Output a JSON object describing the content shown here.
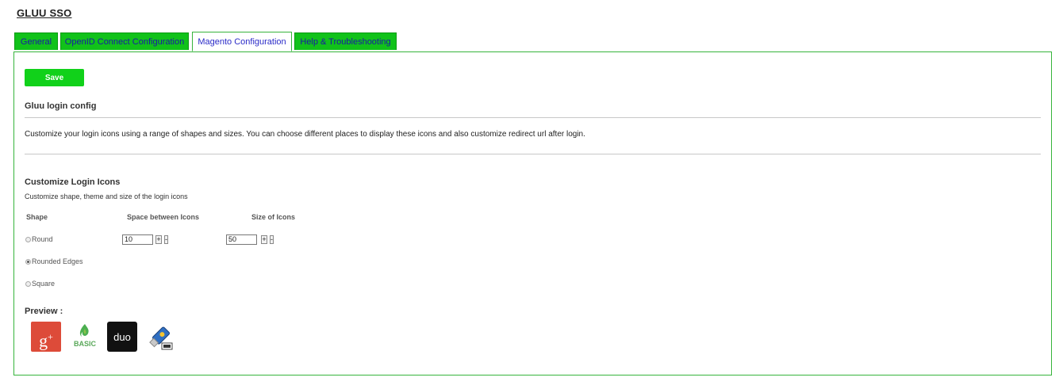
{
  "app": {
    "title": "GLUU SSO"
  },
  "tabs": [
    {
      "label": "General",
      "active": false
    },
    {
      "label": "OpenID Connect Configuration",
      "active": false
    },
    {
      "label": "Magento Configuration",
      "active": true
    },
    {
      "label": "Help & Troubleshooting",
      "active": false
    }
  ],
  "panel": {
    "save_label": "Save",
    "section_title": "Gluu login config",
    "description": "Customize your login icons using a range of shapes and sizes. You can choose different places to display these icons and also customize redirect url after login.",
    "customize_title": "Customize Login Icons",
    "customize_desc": "Customize shape, theme and size of the login icons",
    "columns": {
      "shape": "Shape",
      "space": "Space between Icons",
      "size": "Size of Icons"
    },
    "shapes": [
      {
        "label": "Round",
        "checked": false
      },
      {
        "label": "Rounded Edges",
        "checked": true
      },
      {
        "label": "Square",
        "checked": false
      }
    ],
    "space_value": "10",
    "size_value": "50",
    "plus": "+",
    "minus": "-",
    "preview_label": "Preview :",
    "icons": {
      "google": "google-plus-icon",
      "basic": "basic-icon",
      "duo": "duo-icon",
      "u2f": "u2f-usb-key-icon"
    },
    "icon_text": {
      "google_g": "g",
      "google_plus": "+",
      "basic": "BASIC",
      "duo": "duo"
    }
  },
  "colors": {
    "accent_green": "#11c21a",
    "tab_text": "#1a1aa6",
    "border_green": "#36b43b",
    "google_red": "#dd4b39"
  }
}
